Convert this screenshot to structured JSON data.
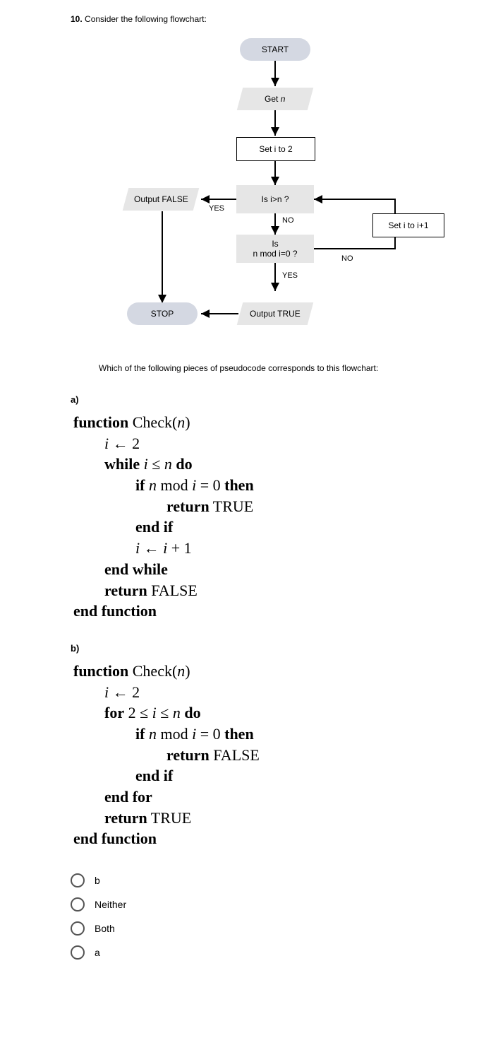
{
  "question": {
    "number": "10.",
    "text": "Consider the following flowchart:"
  },
  "flow": {
    "start": "START",
    "get_n": "Get n",
    "set_i_2": "Set i to 2",
    "is_i_gt_n": "Is i>n ?",
    "output_false": "Output FALSE",
    "yes1": "YES",
    "no1": "NO",
    "is_mod": "Is\nn mod i=0 ?",
    "no2": "NO",
    "set_i_inc": "Set i to i+1",
    "yes2": "YES",
    "output_true": "Output TRUE",
    "stop": "STOP"
  },
  "subq": "Which of the following pieces of pseudocode corresponds to this flowchart:",
  "parts": {
    "a_label": "a)",
    "b_label": "b)"
  },
  "options": {
    "o1": "b",
    "o2": "Neither",
    "o3": "Both",
    "o4": "a"
  }
}
